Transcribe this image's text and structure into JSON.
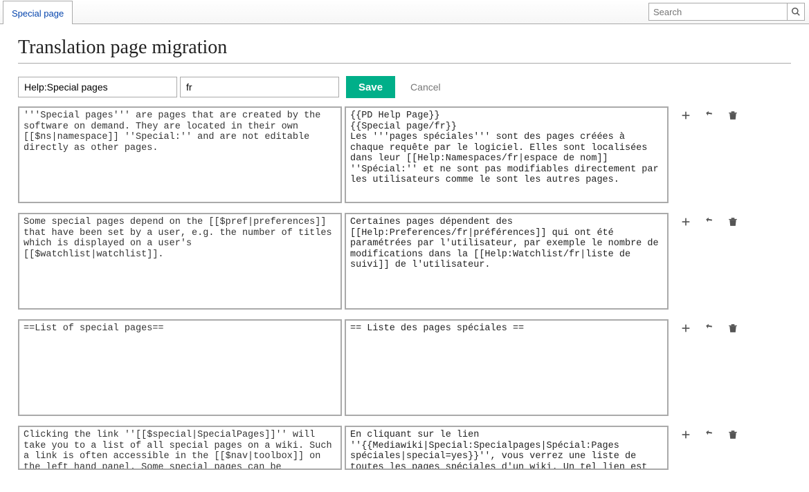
{
  "topTab": "Special page",
  "search": {
    "placeholder": "Search"
  },
  "heading": "Translation page migration",
  "form": {
    "titleValue": "Help:Special pages",
    "langValue": "fr",
    "saveLabel": "Save",
    "cancelLabel": "Cancel"
  },
  "units": [
    {
      "source": "'''Special pages''' are pages that are created by the software on demand. They are located in their own [[$ns|namespace]] ''Special:'' and are not editable directly as other pages.",
      "target": "{{PD Help Page}}\n{{Special page/fr}}\nLes '''pages spéciales''' sont des pages créées à chaque requête par le logiciel. Elles sont localisées dans leur [[Help:Namespaces/fr|espace de nom]] ''Spécial:'' et ne sont pas modifiables directement par les utilisateurs comme le sont les autres pages."
    },
    {
      "source": "Some special pages depend on the [[$pref|preferences]] that have been set by a user, e.g. the number of titles which is displayed on a user's [[$watchlist|watchlist]].",
      "target": "Certaines pages dépendent des [[Help:Preferences/fr|préférences]] qui ont été paramétrées par l'utilisateur, par exemple le nombre de modifications dans la [[Help:Watchlist/fr|liste de suivi]] de l'utilisateur."
    },
    {
      "source": "==List of special pages==",
      "target": "== Liste des pages spéciales =="
    },
    {
      "source": "Clicking the link ''[[$special|SpecialPages]]'' will take you to a list of all special pages on a wiki. Such a link is often accessible in the [[$nav|toolbox]] on the left hand panel. Some special pages can be [[$transclusion|transcluded]].",
      "target": "En cliquant sur le lien ''{{Mediawiki|Special:Specialpages|Spécial:Pages spéciales|special=yes}}'', vous verrez une liste de toutes les pages spéciales d'un wiki. Un tel lien est souvent accessible"
    }
  ]
}
